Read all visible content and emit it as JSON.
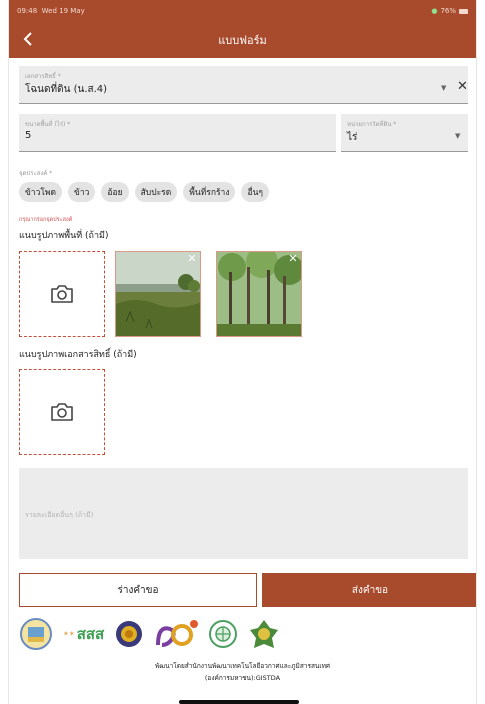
{
  "status": {
    "time": "09:48",
    "date": "Wed 19 May",
    "battery": "76%"
  },
  "appbar": {
    "title": "แบบฟอร์ม"
  },
  "fields": {
    "document": {
      "label": "เอกสารสิทธิ์ *",
      "value": "โฉนดที่ดิน (น.ส.4)"
    },
    "area": {
      "label": "ขนาดพื้นที่ (ไร่) *",
      "value": "5"
    },
    "unit": {
      "label": "หน่วยการวัดที่ดิน *",
      "value": "ไร่"
    }
  },
  "purpose": {
    "label": "จุดประสงค์ *",
    "chips": [
      "ข้าวโพด",
      "ข้าว",
      "อ้อย",
      "สับปะรด",
      "พื้นที่รกร้าง",
      "อื่นๆ"
    ],
    "error": "กรุณากรอกจุดประสงค์"
  },
  "photos": {
    "area_heading": "แนบรูปภาพพื้นที่ (ถ้ามี)",
    "doc_heading": "แนบรูปภาพเอกสารสิทธิ์ (ถ้ามี)"
  },
  "details": {
    "placeholder": "รายละเอียดอื่นๆ (ถ้ามี)"
  },
  "buttons": {
    "draft": "ร่างคำขอ",
    "submit": "ส่งคำขอ"
  },
  "footer": {
    "line1": "พัฒนาโดยสำนักงานพัฒนาเทคโนโลยีอวกาศและภูมิสารสนเทศ",
    "line2": "(องค์การมหาชน):GISTDA",
    "logo_text": "สสส"
  },
  "colors": {
    "brand": "#a84a2c",
    "field_bg": "#ececec",
    "error": "#d05050"
  }
}
